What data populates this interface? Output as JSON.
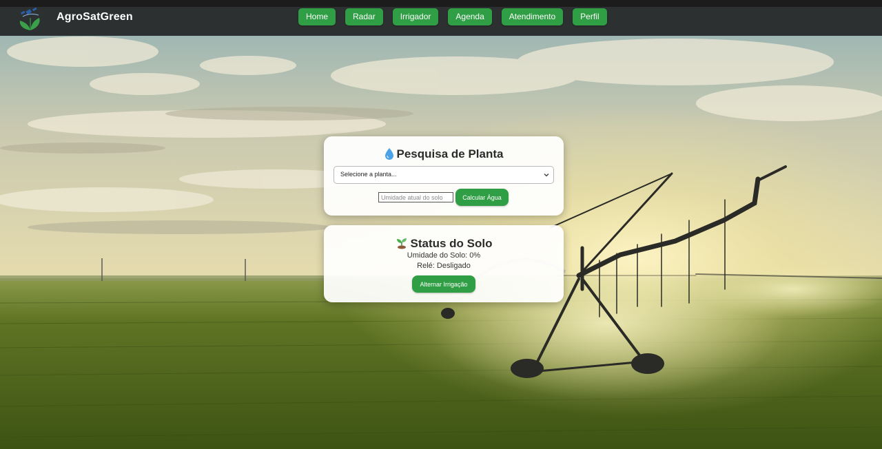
{
  "header": {
    "brand": "AgroSatGreen",
    "nav": [
      "Home",
      "Radar",
      "Irrigador",
      "Agenda",
      "Atendimento",
      "Perfil"
    ]
  },
  "search_card": {
    "title": "Pesquisa de Planta",
    "icon": "water-drop-icon",
    "select_value": "Selecione a planta...",
    "moisture_placeholder": "Umidade atual do solo",
    "calc_button": "Calcular Água"
  },
  "status_card": {
    "title": "Status do Solo",
    "icon": "seedling-icon",
    "umidade": "Umidade do Solo: 0%",
    "rele": "Relé: Desligado",
    "toggle_button": "Alternar Irrigação"
  },
  "colors": {
    "accent": "#2f9e44",
    "navbar": "#1e1e1e",
    "card": "#ffffff"
  }
}
